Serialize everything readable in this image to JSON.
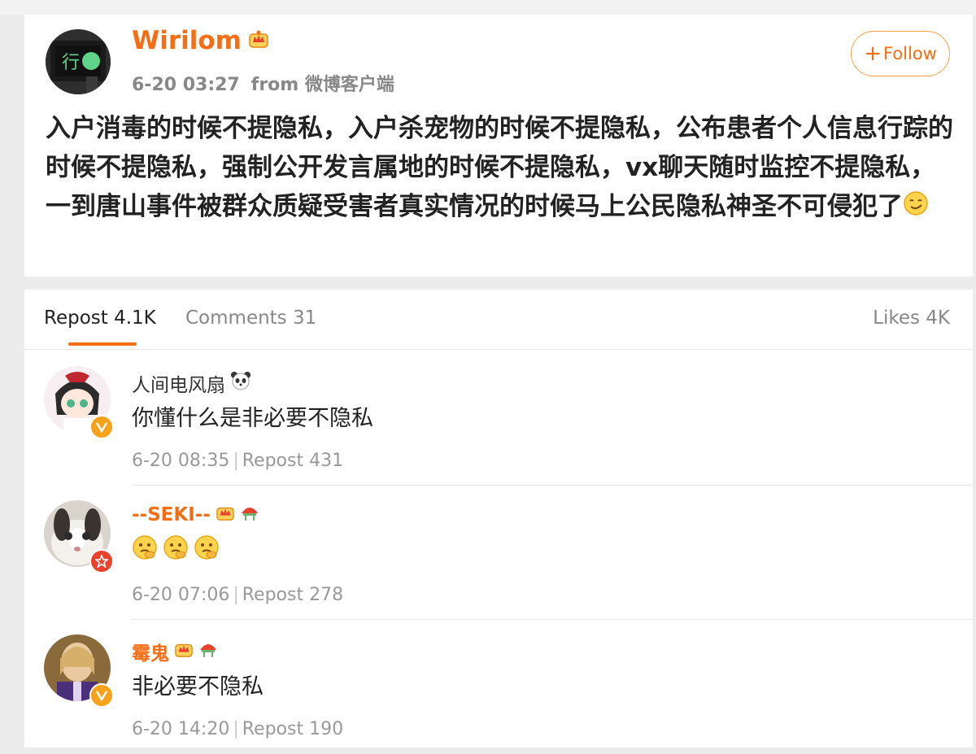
{
  "post": {
    "username": "Wirilom",
    "time": "6-20 03:27",
    "source": "from 微博客户端",
    "follow_label": "Follow",
    "text": "入户消毒的时候不提隐私，入户杀宠物的时候不提隐私，公布患者个人信息行踪的时候不提隐私，强制公开发言属地的时候不提隐私，vx聊天随时监控不提隐私，一到唐山事件被群众质疑受害者真实情况的时候马上公民隐私神圣不可侵犯了",
    "icons": [
      "crown-badge-icon",
      "smirk-emoji-icon"
    ]
  },
  "tabs": {
    "repost": "Repost 4.1K",
    "comments": "Comments 31",
    "likes": "Likes 4K"
  },
  "reposts": [
    {
      "name": "人间电风扇",
      "text": "你懂什么是非必要不隐私",
      "time": "6-20 08:35",
      "repost": "Repost 431",
      "badge_color": "#f7a21b",
      "name_style": "plain"
    },
    {
      "name": "--SEKI--",
      "text": "",
      "time": "6-20 07:06",
      "repost": "Repost 278",
      "badge_color": "#e8412c",
      "name_style": "vip"
    },
    {
      "name": "霉鬼",
      "text": "非必要不隐私",
      "time": "6-20 14:20",
      "repost": "Repost 190",
      "badge_color": "#f7a21b",
      "name_style": "vip"
    }
  ],
  "colors": {
    "accent": "#f56e14",
    "muted": "#888888",
    "divider": "#e6e6e6"
  }
}
